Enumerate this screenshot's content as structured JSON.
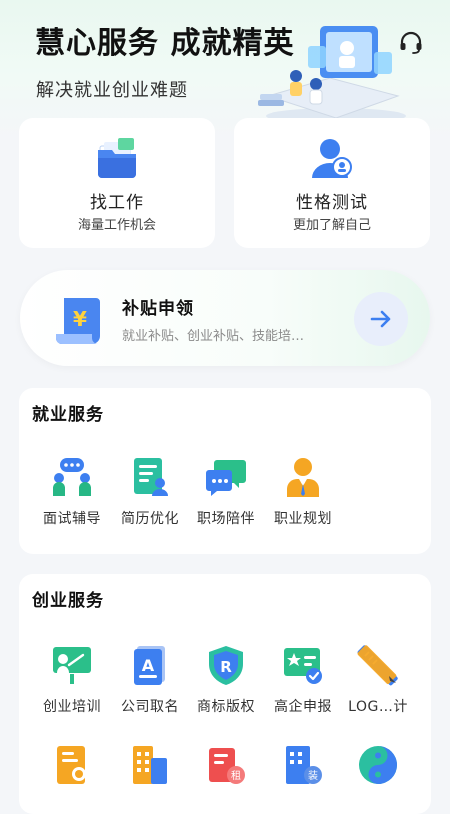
{
  "header": {
    "title": "慧心服务 成就精英",
    "subtitle": "解决就业创业难题",
    "support_icon": "headset-icon"
  },
  "quick_cards": [
    {
      "title": "找工作",
      "subtitle": "海量工作机会",
      "icon": "folder-briefcase-icon"
    },
    {
      "title": "性格测试",
      "subtitle": "更加了解自己",
      "icon": "user-badge-icon"
    }
  ],
  "subsidy": {
    "title": "补贴申领",
    "description": "就业补贴、创业补贴、技能培…",
    "icon": "yuan-document-icon",
    "action_icon": "arrow-right-icon"
  },
  "employment_services": {
    "title": "就业服务",
    "items": [
      {
        "label": "面试辅导",
        "icon": "interview-chat-icon"
      },
      {
        "label": "简历优化",
        "icon": "resume-icon"
      },
      {
        "label": "职场陪伴",
        "icon": "message-bubbles-icon"
      },
      {
        "label": "职业规划",
        "icon": "professional-person-icon"
      }
    ]
  },
  "startup_services": {
    "title": "创业服务",
    "items": [
      {
        "label": "创业培训",
        "icon": "training-board-icon"
      },
      {
        "label": "公司取名",
        "icon": "naming-book-icon"
      },
      {
        "label": "商标版权",
        "icon": "trademark-shield-icon"
      },
      {
        "label": "高企申报",
        "icon": "certificate-check-icon"
      },
      {
        "label": "LOG…计",
        "icon": "pencil-ruler-icon"
      }
    ],
    "row2_icons": [
      {
        "icon": "company-card-icon"
      },
      {
        "icon": "office-building-icon"
      },
      {
        "icon": "rent-document-icon"
      },
      {
        "icon": "decoration-building-icon"
      },
      {
        "icon": "yin-yang-icon"
      }
    ]
  },
  "colors": {
    "accent_blue": "#3d7ff0",
    "accent_green": "#27b785",
    "accent_orange": "#f5a623",
    "accent_red": "#ee4f4f"
  }
}
